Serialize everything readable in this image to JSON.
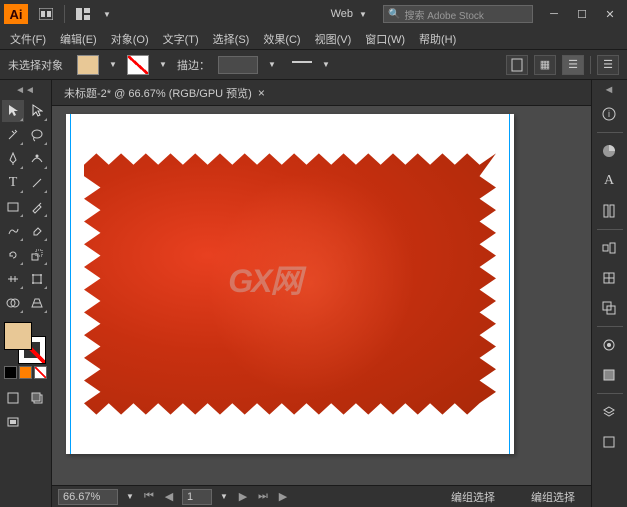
{
  "app": {
    "logo": "Ai"
  },
  "titlebar": {
    "preset": "Web",
    "search_placeholder": "搜索 Adobe Stock"
  },
  "menu": {
    "file": "文件(F)",
    "edit": "编辑(E)",
    "object": "对象(O)",
    "type": "文字(T)",
    "select": "选择(S)",
    "effect": "效果(C)",
    "view": "视图(V)",
    "window": "窗口(W)",
    "help": "帮助(H)"
  },
  "controlbar": {
    "selection": "未选择对象",
    "stroke_label": "描边：",
    "fill_color": "#e8c896"
  },
  "document": {
    "tab_title": "未标题-2* @ 66.67% (RGB/GPU 预览)"
  },
  "canvas": {
    "watermark": "GX网"
  },
  "status": {
    "zoom": "66.67%",
    "page": "1",
    "mode1": "编组选择",
    "mode2": "编组选择"
  }
}
